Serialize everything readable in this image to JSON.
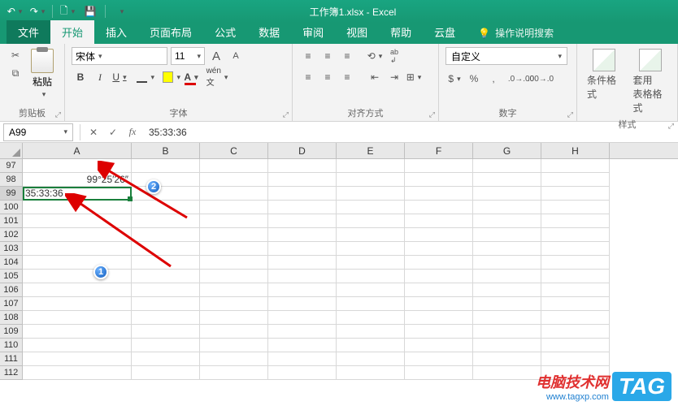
{
  "title": "工作簿1.xlsx - Excel",
  "tabs": {
    "file": "文件",
    "home": "开始",
    "insert": "插入",
    "layout": "页面布局",
    "formulas": "公式",
    "data": "数据",
    "review": "审阅",
    "view": "视图",
    "help": "帮助",
    "cloud": "云盘",
    "tell": "操作说明搜索"
  },
  "ribbon": {
    "clipboard": {
      "paste": "粘贴",
      "label": "剪贴板"
    },
    "font": {
      "name": "宋体",
      "size": "11",
      "label": "字体"
    },
    "align": {
      "label": "对齐方式"
    },
    "number": {
      "format": "自定义",
      "label": "数字"
    },
    "styles": {
      "cond": "条件格式",
      "table": "套用\n表格格式",
      "label": "样式"
    }
  },
  "formula_bar": {
    "name": "A99",
    "value": "35:33:36"
  },
  "columns": [
    "A",
    "B",
    "C",
    "D",
    "E",
    "F",
    "G",
    "H"
  ],
  "rows": [
    97,
    98,
    99,
    100,
    101,
    102,
    103,
    104,
    105,
    106,
    107,
    108,
    109,
    110,
    111,
    112
  ],
  "cells": {
    "A98": "99°25′26″",
    "A99": "35:33:36"
  },
  "active": {
    "row": 99,
    "col": "A"
  },
  "markers": {
    "1": "1",
    "2": "2"
  },
  "watermark": {
    "cn": "电脑技术网",
    "url": "www.tagxp.com",
    "tag": "TAG"
  }
}
